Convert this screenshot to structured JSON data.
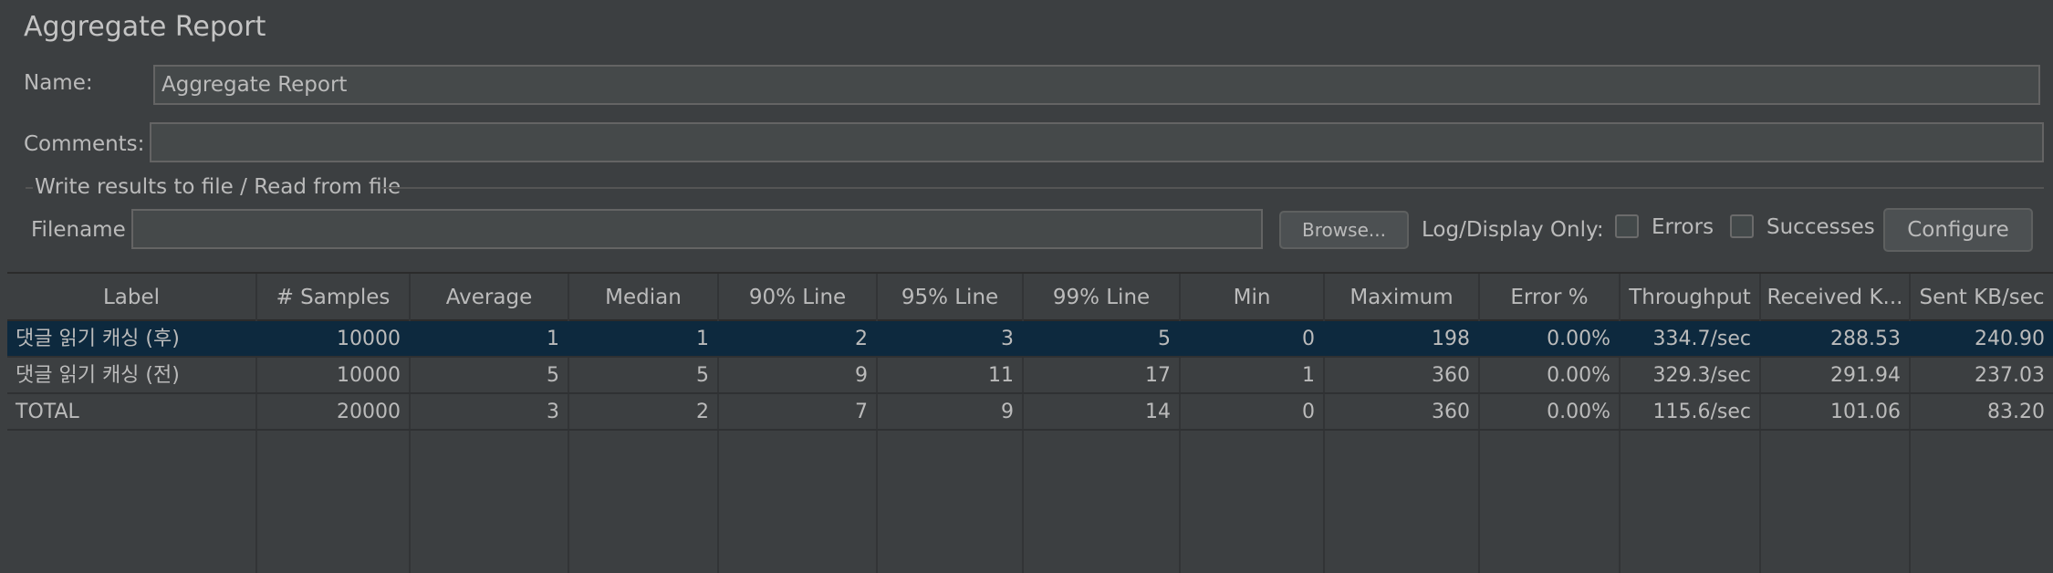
{
  "panel": {
    "title": "Aggregate Report",
    "name_label": "Name:",
    "name_value": "Aggregate Report",
    "comments_label": "Comments:",
    "comments_value": ""
  },
  "file_section": {
    "title": "Write results to file / Read from file",
    "filename_label": "Filename",
    "filename_value": "",
    "browse_label": "Browse...",
    "log_display_label": "Log/Display Only:",
    "errors_label": "Errors",
    "errors_checked": false,
    "successes_label": "Successes",
    "successes_checked": false,
    "configure_label": "Configure"
  },
  "table": {
    "columns": [
      "Label",
      "# Samples",
      "Average",
      "Median",
      "90% Line",
      "95% Line",
      "99% Line",
      "Min",
      "Maximum",
      "Error %",
      "Throughput",
      "Received K...",
      "Sent KB/sec"
    ],
    "rows": [
      [
        "댓글 읽기 캐싱 (후)",
        "10000",
        "1",
        "1",
        "2",
        "3",
        "5",
        "0",
        "198",
        "0.00%",
        "334.7/sec",
        "288.53",
        "240.90"
      ],
      [
        "댓글 읽기 캐싱 (전)",
        "10000",
        "5",
        "5",
        "9",
        "11",
        "17",
        "1",
        "360",
        "0.00%",
        "329.3/sec",
        "291.94",
        "237.03"
      ],
      [
        "TOTAL",
        "20000",
        "3",
        "2",
        "7",
        "9",
        "14",
        "0",
        "360",
        "0.00%",
        "115.6/sec",
        "101.06",
        "83.20"
      ]
    ],
    "selected_row": 0
  },
  "colors": {
    "background": "#3c3f41",
    "selection": "#0d293e",
    "text": "#bbbbbb"
  }
}
